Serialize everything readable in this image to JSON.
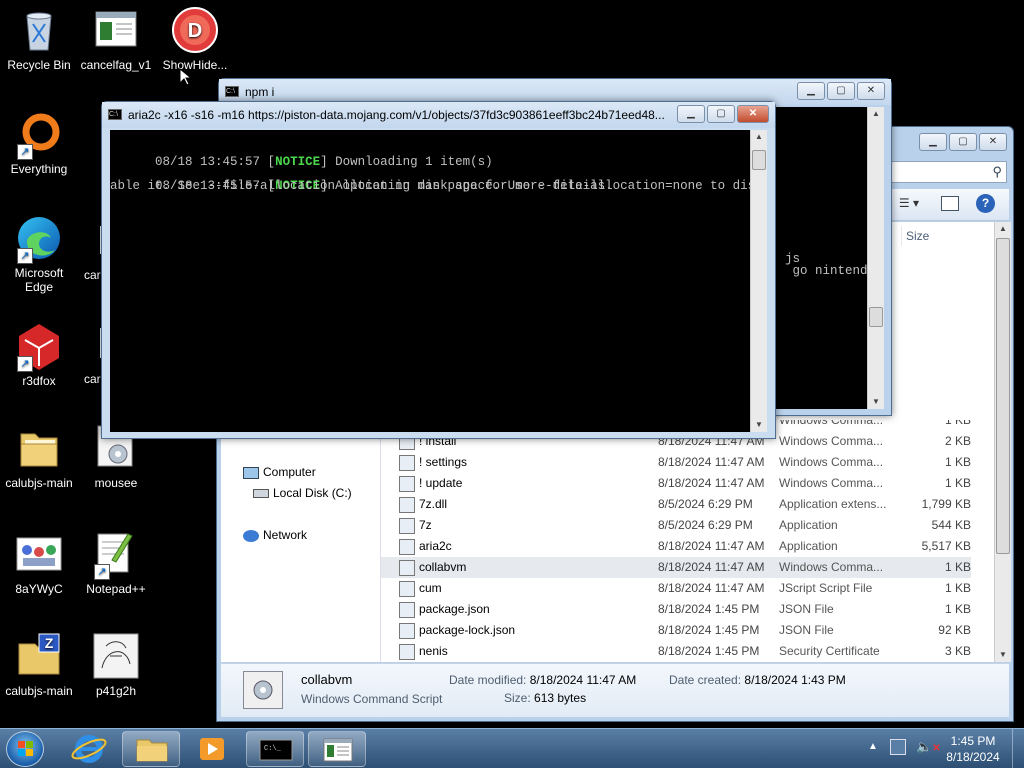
{
  "desktop": {
    "icons": [
      {
        "label": "Recycle Bin",
        "icon": "recycle-bin-icon"
      },
      {
        "label": "cancelfag_v1",
        "icon": "document-icon"
      },
      {
        "label": "ShowHide...",
        "icon": "d-badge-icon"
      },
      {
        "label": "Everything",
        "icon": "everything-icon"
      },
      {
        "label": "car",
        "icon": "file-icon"
      },
      {
        "label": "Microsoft Edge",
        "icon": "edge-icon"
      },
      {
        "label": "car",
        "icon": "file-icon"
      },
      {
        "label": "r3dfox",
        "icon": "r3dfox-icon"
      },
      {
        "label": "car",
        "icon": "file-icon"
      },
      {
        "label": "calubjs-main",
        "icon": "folder-icon"
      },
      {
        "label": "mousee",
        "icon": "gear-file-icon"
      },
      {
        "label": "8aYWyC",
        "icon": "image-icon"
      },
      {
        "label": "Notepad++",
        "icon": "notepadpp-icon"
      },
      {
        "label": "calubjs-main",
        "icon": "zip-folder-icon"
      },
      {
        "label": "p41g2h",
        "icon": "image-icon"
      }
    ]
  },
  "npm_window": {
    "title": "npm i",
    "lines": [
      "js",
      " go nintend"
    ]
  },
  "aria_window": {
    "title": "aria2c  -x16 -s16 -m16 https://piston-data.mojang.com/v1/objects/37fd3c903861eeff3bc24b71eed48...",
    "log": [
      {
        "time": "08/18 13:45:57",
        "tag": "NOTICE",
        "text": " Downloading 1 item(s)"
      },
      {
        "time": "08/18 13:45:57",
        "tag": "NOTICE",
        "text": " Allocating disk space. Use --file-allocation=none to dis"
      }
    ],
    "wrap_lines": [
      "able it. See --file-allocation option in man page for more details."
    ]
  },
  "explorer": {
    "column_size": "Size",
    "nav": [
      {
        "label": "Computer",
        "icon": "computer-icon"
      },
      {
        "label": "Local Disk (C:)",
        "icon": "drive-icon"
      },
      {
        "label": "Network",
        "icon": "network-icon"
      }
    ],
    "files": [
      {
        "name": "",
        "date": "",
        "type": "Windows Comma...",
        "size": "1 KB"
      },
      {
        "name": "! install",
        "date": "8/18/2024 11:47 AM",
        "type": "Windows Comma...",
        "size": "2 KB"
      },
      {
        "name": "! settings",
        "date": "8/18/2024 11:47 AM",
        "type": "Windows Comma...",
        "size": "1 KB"
      },
      {
        "name": "! update",
        "date": "8/18/2024 11:47 AM",
        "type": "Windows Comma...",
        "size": "1 KB"
      },
      {
        "name": "7z.dll",
        "date": "8/5/2024 6:29 PM",
        "type": "Application extens...",
        "size": "1,799 KB"
      },
      {
        "name": "7z",
        "date": "8/5/2024 6:29 PM",
        "type": "Application",
        "size": "544 KB"
      },
      {
        "name": "aria2c",
        "date": "8/18/2024 11:47 AM",
        "type": "Application",
        "size": "5,517 KB"
      },
      {
        "name": "collabvm",
        "date": "8/18/2024 11:47 AM",
        "type": "Windows Comma...",
        "size": "1 KB"
      },
      {
        "name": "cum",
        "date": "8/18/2024 11:47 AM",
        "type": "JScript Script File",
        "size": "1 KB"
      },
      {
        "name": "package.json",
        "date": "8/18/2024 1:45 PM",
        "type": "JSON File",
        "size": "1 KB"
      },
      {
        "name": "package-lock.json",
        "date": "8/18/2024 1:45 PM",
        "type": "JSON File",
        "size": "92 KB"
      },
      {
        "name": "nenis",
        "date": "8/18/2024 1:45 PM",
        "type": "Security Certificate",
        "size": "3 KB"
      }
    ],
    "selected_index": 7,
    "details": {
      "name": "collabvm",
      "type": "Windows Command Script",
      "modified_label": "Date modified:",
      "modified": "8/18/2024 11:47 AM",
      "created_label": "Date created:",
      "created": "8/18/2024 1:43 PM",
      "size_label": "Size:",
      "size": "613 bytes"
    }
  },
  "taskbar": {
    "time": "1:45 PM",
    "date": "8/18/2024"
  }
}
